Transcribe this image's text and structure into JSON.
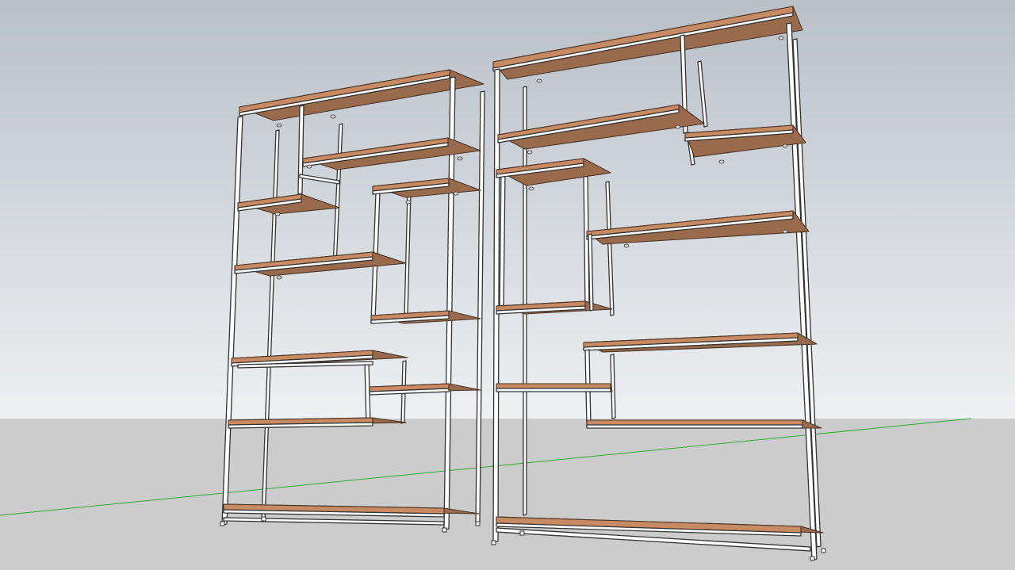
{
  "viewport": {
    "sky_top_color": "#b8c0c8",
    "sky_bottom_color": "#eef0f2",
    "ground_color": "#cccccc",
    "axis_color": "#2eaa2e",
    "edge_color": "#333333",
    "frame_color": "#ffffff",
    "wood_top_color": "#9a6a4c",
    "wood_front_color": "#c88a62"
  },
  "model": {
    "object": "bookshelf",
    "count": 2
  }
}
